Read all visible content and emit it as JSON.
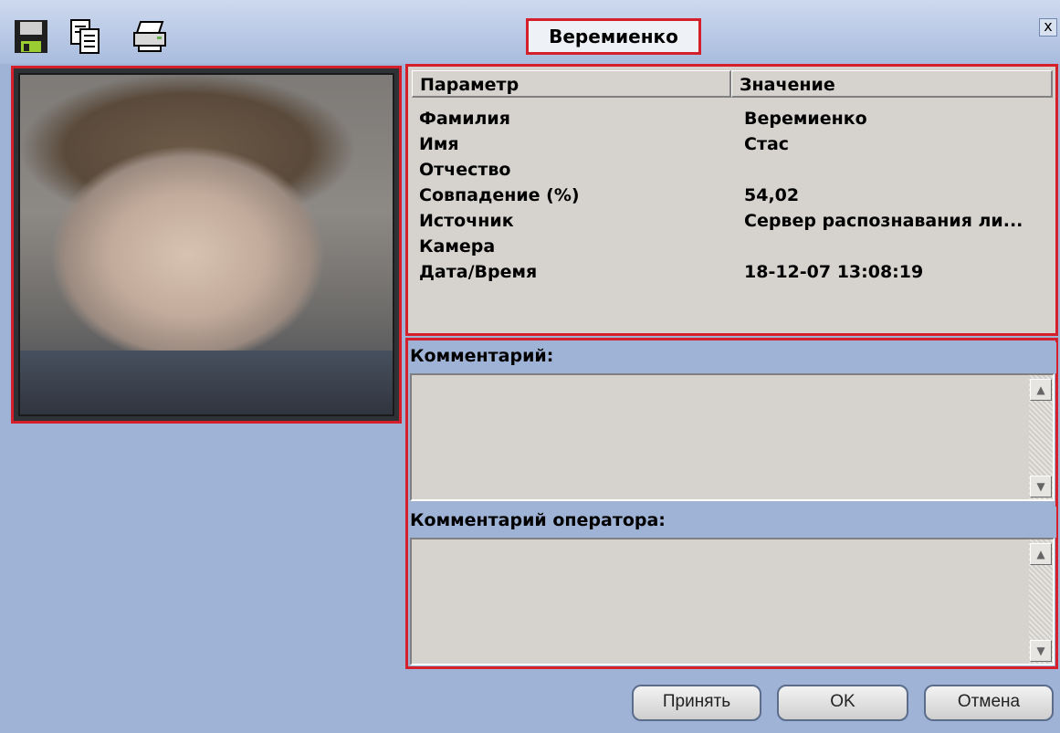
{
  "window": {
    "title": "Веремиенко",
    "close_label": "x",
    "toolbar_icons": [
      "save-icon",
      "copy-icon",
      "print-icon"
    ]
  },
  "info_table": {
    "headers": [
      "Параметр",
      "Значение"
    ],
    "rows": [
      {
        "param": "Фамилия",
        "value": "Веремиенко"
      },
      {
        "param": "Имя",
        "value": "Стас"
      },
      {
        "param": "Отчество",
        "value": ""
      },
      {
        "param": "Совпадение (%)",
        "value": "54,02"
      },
      {
        "param": "Источник",
        "value": "Сервер распознавания ли..."
      },
      {
        "param": "Камера",
        "value": ""
      },
      {
        "param": "Дата/Время",
        "value": "18-12-07 13:08:19"
      }
    ]
  },
  "comments": {
    "comment_label": "Комментарий:",
    "comment_value": "",
    "operator_label": "Комментарий оператора:",
    "operator_value": ""
  },
  "buttons": {
    "accept": "Принять",
    "ok": "OK",
    "cancel": "Отмена"
  },
  "colors": {
    "background": "#9fb3d6",
    "highlight": "#d51f2a",
    "panel": "#d6d3ce"
  }
}
